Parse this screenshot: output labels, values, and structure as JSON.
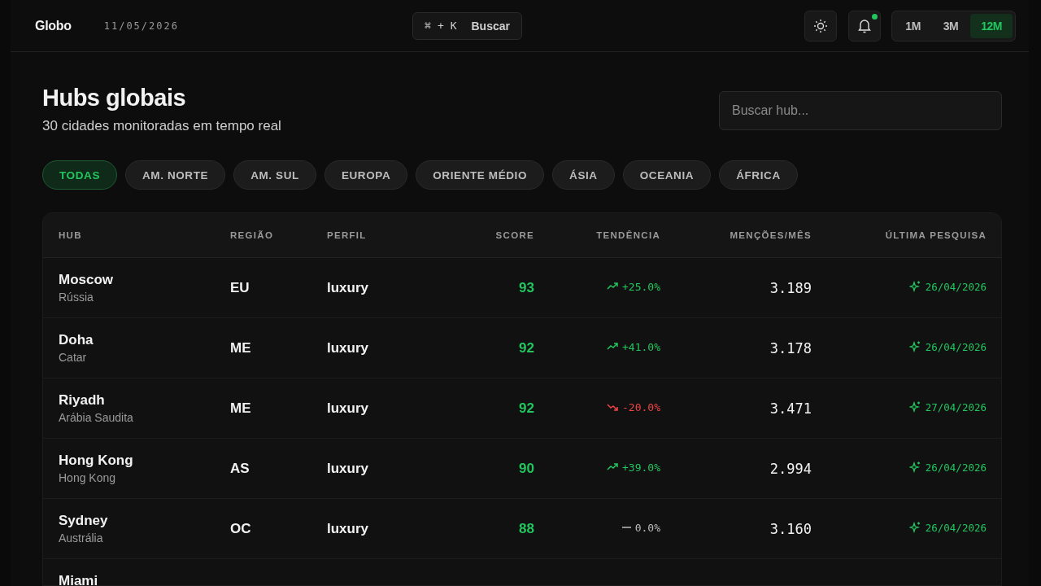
{
  "header": {
    "brand": "Globo",
    "date": "11/05/2026",
    "command": {
      "keys": "⌘ + K",
      "label": "Buscar"
    },
    "notification_dot": true,
    "periods": [
      {
        "label": "1M",
        "selected": false
      },
      {
        "label": "3M",
        "selected": false
      },
      {
        "label": "12M",
        "selected": true
      }
    ]
  },
  "title": "Hubs globais",
  "subtitle": "30 cidades monitoradas em tempo real",
  "search": {
    "placeholder": "Buscar hub..."
  },
  "filters": [
    {
      "label": "TODAS",
      "selected": true
    },
    {
      "label": "AM. NORTE",
      "selected": false
    },
    {
      "label": "AM. SUL",
      "selected": false
    },
    {
      "label": "EUROPA",
      "selected": false
    },
    {
      "label": "ORIENTE MÉDIO",
      "selected": false
    },
    {
      "label": "ÁSIA",
      "selected": false
    },
    {
      "label": "OCEANIA",
      "selected": false
    },
    {
      "label": "ÁFRICA",
      "selected": false
    }
  ],
  "table": {
    "columns": [
      "HUB",
      "REGIÃO",
      "PERFIL",
      "SCORE",
      "TENDÊNCIA",
      "MENÇÕES/MÊS",
      "ÚLTIMA PESQUISA"
    ],
    "rows": [
      {
        "hub": "Moscow",
        "country": "Rússia",
        "region": "EU",
        "profile": "luxury",
        "score": "93",
        "trend": {
          "kind": "up",
          "text": "+25.0%"
        },
        "mentions": "3.189",
        "last": "26/04/2026"
      },
      {
        "hub": "Doha",
        "country": "Catar",
        "region": "ME",
        "profile": "luxury",
        "score": "92",
        "trend": {
          "kind": "up",
          "text": "+41.0%"
        },
        "mentions": "3.178",
        "last": "26/04/2026"
      },
      {
        "hub": "Riyadh",
        "country": "Arábia Saudita",
        "region": "ME",
        "profile": "luxury",
        "score": "92",
        "trend": {
          "kind": "down",
          "text": "-20.0%"
        },
        "mentions": "3.471",
        "last": "27/04/2026"
      },
      {
        "hub": "Hong Kong",
        "country": "Hong Kong",
        "region": "AS",
        "profile": "luxury",
        "score": "90",
        "trend": {
          "kind": "up",
          "text": "+39.0%"
        },
        "mentions": "2.994",
        "last": "26/04/2026"
      },
      {
        "hub": "Sydney",
        "country": "Austrália",
        "region": "OC",
        "profile": "luxury",
        "score": "88",
        "trend": {
          "kind": "flat",
          "text": "0.0%"
        },
        "mentions": "3.160",
        "last": "26/04/2026"
      },
      {
        "hub": "Miami"
      }
    ]
  }
}
